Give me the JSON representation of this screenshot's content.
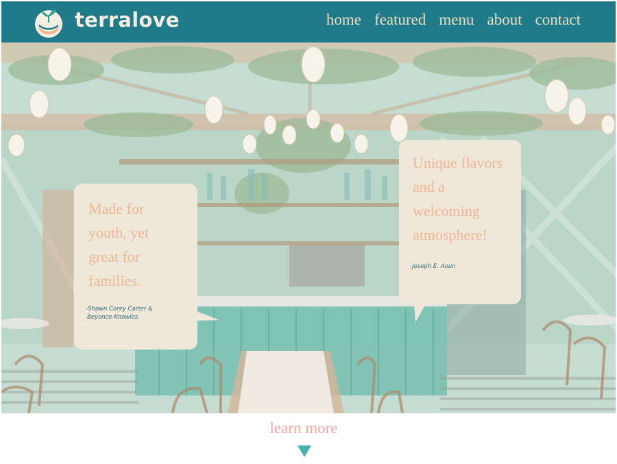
{
  "header": {
    "brand": "terralove",
    "nav": [
      "home",
      "featured",
      "menu",
      "about",
      "contact"
    ]
  },
  "quotes": [
    {
      "text": "Made for youth, yet great for families.",
      "author_line1": "-Shawn Corey Carter &",
      "author_line2": "Beyonce Knowles"
    },
    {
      "text": "Unique flavors and a welcoming atmosphere!",
      "author_line1": "-Joseph E. Aoun"
    }
  ],
  "cta": {
    "label": "learn more"
  },
  "colors": {
    "header": "#1f7b89",
    "quote_text": "#ecb792",
    "author": "#2a6b78",
    "cta": "#f1a7a0",
    "arrow": "#46b3a8",
    "bubble": "#efe7da"
  },
  "icons": {
    "logo": "sprouting-planet-logo",
    "scroll": "triangle-down-icon"
  }
}
